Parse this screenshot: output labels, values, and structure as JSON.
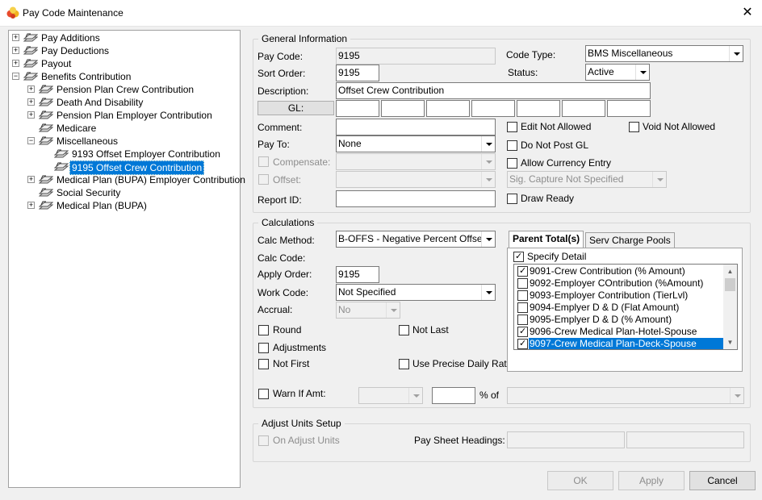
{
  "window": {
    "title": "Pay Code Maintenance"
  },
  "tree": {
    "items": [
      {
        "label": "Pay Additions",
        "expand": "+"
      },
      {
        "label": "Pay Deductions",
        "expand": "+"
      },
      {
        "label": "Payout",
        "expand": "+"
      },
      {
        "label": "Benefits Contribution",
        "expand": "−"
      },
      {
        "label": "Pension Plan Crew Contribution",
        "expand": "+"
      },
      {
        "label": "Death And Disability",
        "expand": "+"
      },
      {
        "label": "Pension Plan Employer Contribution",
        "expand": "+"
      },
      {
        "label": "Medicare",
        "expand": ""
      },
      {
        "label": "Miscellaneous",
        "expand": "−"
      },
      {
        "label": "9193 Offset Employer Contribution",
        "expand": ""
      },
      {
        "label": "9195 Offset Crew Contribution",
        "expand": ""
      },
      {
        "label": "Medical Plan (BUPA) Employer Contribution",
        "expand": "+"
      },
      {
        "label": "Social Security",
        "expand": ""
      },
      {
        "label": "Medical Plan (BUPA)",
        "expand": "+"
      }
    ]
  },
  "general": {
    "legend": "General Information",
    "pay_code_label": "Pay Code:",
    "pay_code": "9195",
    "sort_order_label": "Sort Order:",
    "sort_order": "9195",
    "description_label": "Description:",
    "description": "Offset Crew Contribution",
    "gl_button": "GL:",
    "comment_label": "Comment:",
    "comment": "",
    "pay_to_label": "Pay To:",
    "pay_to": "None",
    "compensate_label": "Compensate:",
    "offset_label": "Offset:",
    "report_id_label": "Report ID:",
    "report_id": "",
    "code_type_label": "Code Type:",
    "code_type": "BMS Miscellaneous",
    "status_label": "Status:",
    "status": "Active",
    "edit_not_allowed": "Edit Not Allowed",
    "void_not_allowed": "Void Not Allowed",
    "do_not_post_gl": "Do Not Post GL",
    "allow_currency_entry": "Allow Currency Entry",
    "sig_capture": "Sig. Capture Not Specified",
    "draw_ready": "Draw Ready"
  },
  "calculations": {
    "legend": "Calculations",
    "calc_method_label": "Calc Method:",
    "calc_method": "B-OFFS - Negative Percent Offset of",
    "calc_code_label": "Calc Code:",
    "apply_order_label": "Apply Order:",
    "apply_order": "9195",
    "work_code_label": "Work Code:",
    "work_code": "Not Specified",
    "accrual_label": "Accrual:",
    "accrual": "No",
    "round": "Round",
    "not_last": "Not Last",
    "adjustments": "Adjustments",
    "not_first": "Not First",
    "use_precise_daily_rate": "Use Precise Daily Rate",
    "warn_if_amt": "Warn If Amt:",
    "percent_of": "% of",
    "tabs": [
      "Parent Total(s)",
      "Serv Charge Pools"
    ],
    "specify_detail": "Specify Detail",
    "parent_totals": [
      {
        "label": "9091-Crew Contribution (% Amount)",
        "checked": true
      },
      {
        "label": "9092-Employer COntribution (%Amount)",
        "checked": false
      },
      {
        "label": "9093-Employer Contribution (TierLvl)",
        "checked": false
      },
      {
        "label": "9094-Emplyer D & D (Flat Amount)",
        "checked": false
      },
      {
        "label": "9095-Emplyer D & D (% Amount)",
        "checked": false
      },
      {
        "label": "9096-Crew Medical Plan-Hotel-Spouse",
        "checked": true
      },
      {
        "label": "9097-Crew Medical Plan-Deck-Spouse",
        "checked": true
      }
    ]
  },
  "adjust_units": {
    "legend": "Adjust Units Setup",
    "on_adjust_units": "On Adjust Units",
    "pay_sheet_headings": "Pay Sheet Headings:"
  },
  "buttons": {
    "ok": "OK",
    "apply": "Apply",
    "cancel": "Cancel"
  },
  "colors": {
    "selection": "#0078d7",
    "window_bg": "#f0f0f0"
  }
}
